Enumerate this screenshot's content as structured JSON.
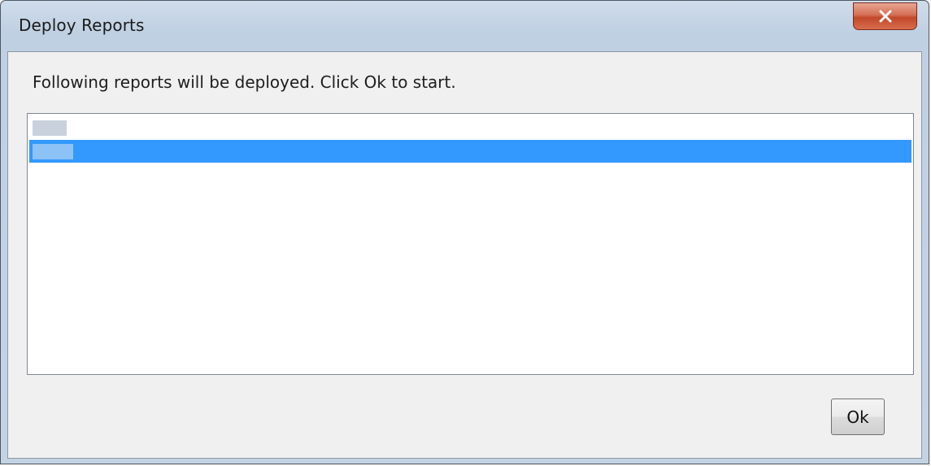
{
  "window": {
    "title": "Deploy Reports",
    "close_icon": "close-icon"
  },
  "dialog": {
    "message": "Following reports will be deployed. Click Ok to start.",
    "ok_label": "Ok"
  },
  "report_list": {
    "items": [
      {
        "label": "",
        "selected": false
      },
      {
        "label": "",
        "selected": true
      }
    ]
  },
  "colors": {
    "selection": "#3399ff",
    "dialog_background": "#f0f0f0",
    "close_button": "#c2482a"
  }
}
